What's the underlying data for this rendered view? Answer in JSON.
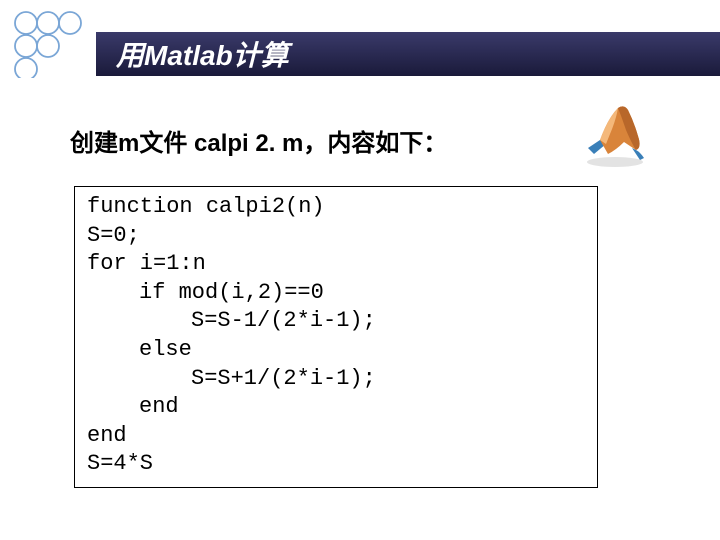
{
  "title": "用Matlab计算",
  "subtitle": "创建m文件 calpi 2. m，内容如下：",
  "code": {
    "l1": "function calpi2(n)",
    "l2": "S=0;",
    "l3": "for i=1:n",
    "l4": "if mod(i,2)==0",
    "l5": "S=S-1/(2*i-1);",
    "l6": "else",
    "l7": "S=S+1/(2*i-1);",
    "l8": "end",
    "l9": "end",
    "l10": "S=4*S"
  }
}
